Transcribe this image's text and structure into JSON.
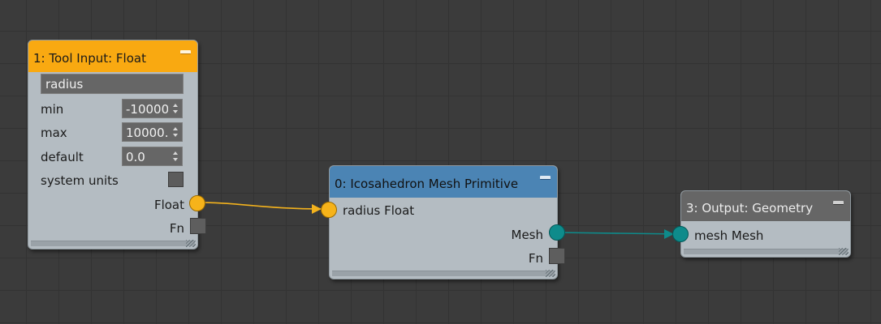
{
  "colors": {
    "canvas": "#3b3b3b",
    "grid": "#333333",
    "node_body": "#b4bcc2",
    "header_input": "#f9a911",
    "header_primitive": "#4b84b4",
    "header_output": "#666666",
    "float_wire": "#f3b21d",
    "mesh_wire": "#0e8a8a"
  },
  "nodes": {
    "tool_input": {
      "title": "1: Tool Input: Float",
      "name_value": "radius",
      "params": [
        {
          "label": "min",
          "value": "-10000"
        },
        {
          "label": "max",
          "value": "10000."
        },
        {
          "label": "default",
          "value": "0.0"
        }
      ],
      "system_units_label": "system units",
      "system_units_checked": false,
      "output_port_label": "Float",
      "fn_label": "Fn"
    },
    "icosahedron": {
      "title": "0: Icosahedron Mesh Primitive",
      "input_label": "radius Float",
      "output_label": "Mesh",
      "fn_label": "Fn"
    },
    "output": {
      "title": "3: Output: Geometry",
      "input_label": "mesh Mesh"
    }
  },
  "wires": [
    {
      "from": "tool_input.Float",
      "to": "icosahedron.radius",
      "type": "Float"
    },
    {
      "from": "icosahedron.Mesh",
      "to": "output.mesh",
      "type": "Mesh"
    }
  ]
}
